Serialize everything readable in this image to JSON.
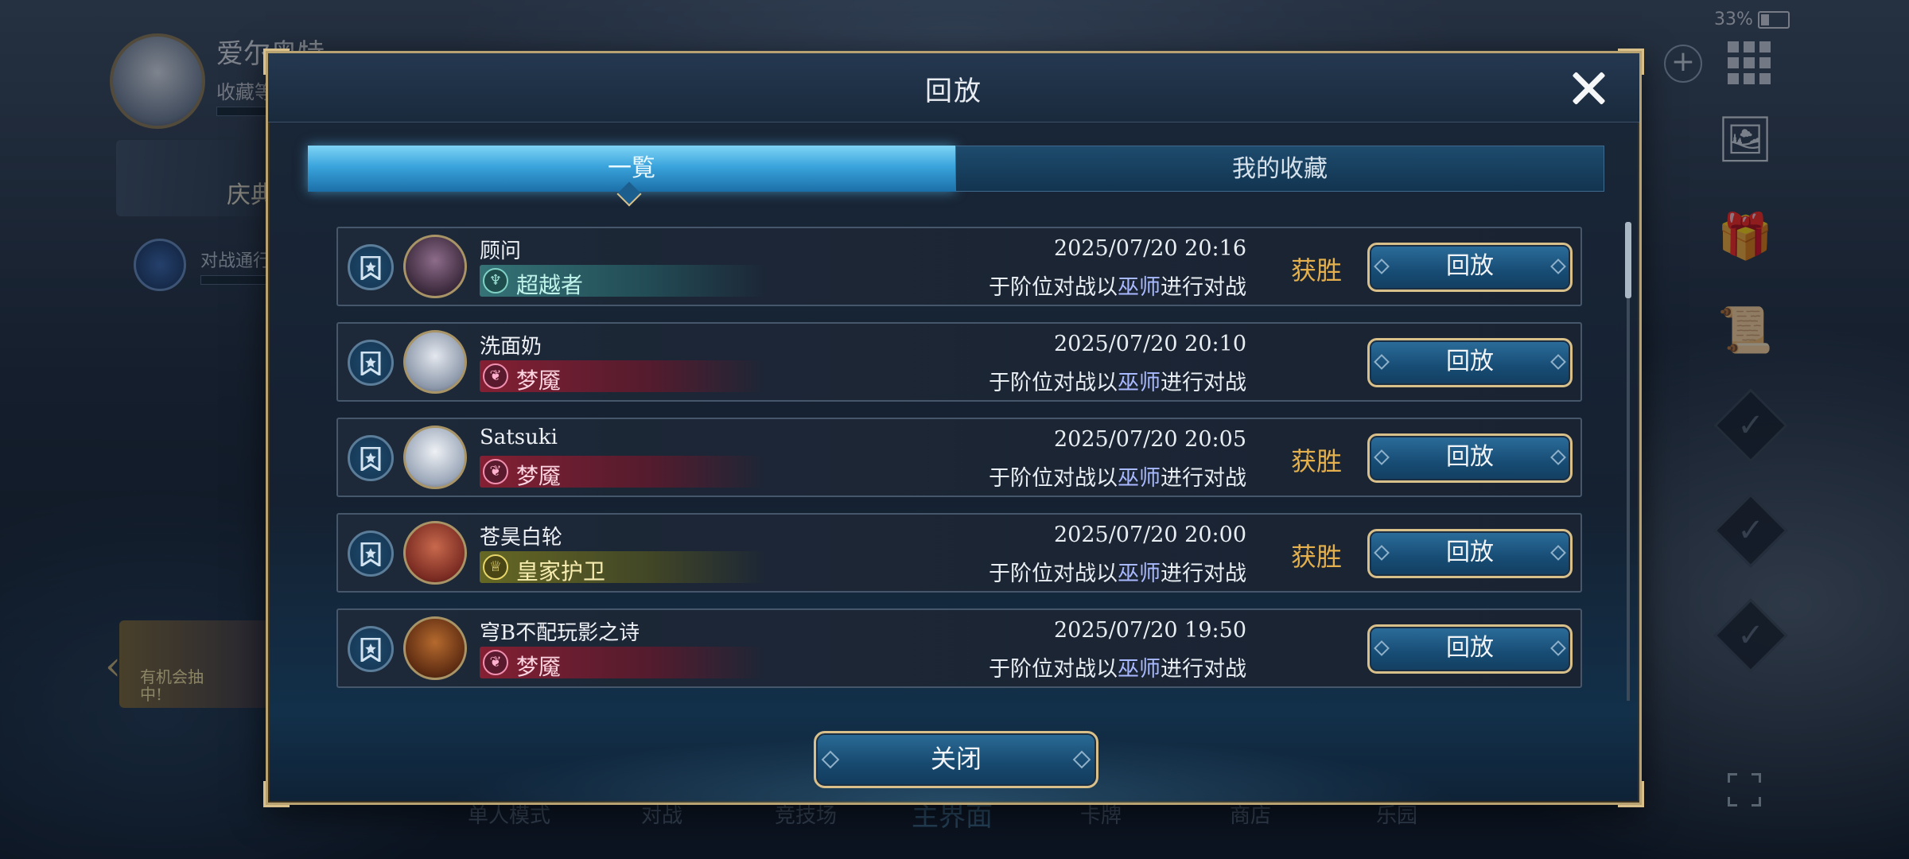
{
  "status_bar": {
    "battery": "33%"
  },
  "background": {
    "player_name": "爱尔奥特",
    "player_sub": "收藏等",
    "card_label": "庆典",
    "battle_pass": "对战通行证",
    "event_text": "有机会抽中!",
    "nav": [
      "单人模式",
      "对战",
      "竞技场",
      "主界面",
      "卡牌",
      "商店",
      "乐园"
    ]
  },
  "modal": {
    "title": "回放",
    "tabs": [
      {
        "label": "一覧",
        "active": true
      },
      {
        "label": "我的收藏",
        "active": false
      }
    ],
    "rows": [
      {
        "name": "顾问",
        "class": "超越者",
        "class_icon": "♆",
        "datetime": "2025/07/20  20:16",
        "mode_prefix": "于阶位对战以",
        "mode_class": "巫师",
        "mode_suffix": "进行对战",
        "result": "获胜",
        "button": "回放"
      },
      {
        "name": "洗面奶",
        "class": "梦魇",
        "class_icon": "❦",
        "datetime": "2025/07/20  20:10",
        "mode_prefix": "于阶位对战以",
        "mode_class": "巫师",
        "mode_suffix": "进行对战",
        "result": "",
        "button": "回放"
      },
      {
        "name": "Satsuki",
        "class": "梦魇",
        "class_icon": "❦",
        "datetime": "2025/07/20  20:05",
        "mode_prefix": "于阶位对战以",
        "mode_class": "巫师",
        "mode_suffix": "进行对战",
        "result": "获胜",
        "button": "回放"
      },
      {
        "name": "苍昊白轮",
        "class": "皇家护卫",
        "class_icon": "♕",
        "datetime": "2025/07/20  20:00",
        "mode_prefix": "于阶位对战以",
        "mode_class": "巫师",
        "mode_suffix": "进行对战",
        "result": "获胜",
        "button": "回放"
      },
      {
        "name": "穹B不配玩影之诗",
        "class": "梦魇",
        "class_icon": "❦",
        "datetime": "2025/07/20  19:50",
        "mode_prefix": "于阶位对战以",
        "mode_class": "巫师",
        "mode_suffix": "进行对战",
        "result": "",
        "button": "回放"
      }
    ],
    "close_button": "关闭"
  },
  "colors": {
    "gold_border": "#d9c08a",
    "win": "#e3b04d",
    "tab_active": "#3aa4dc",
    "class_highlight": "#a9b9ff"
  }
}
